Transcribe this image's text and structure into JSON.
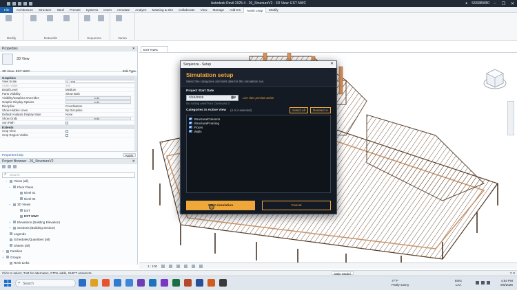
{
  "window": {
    "title": "Autodesk Revit 2025.4 - 26_StructureV2 - 3D View: EST NWC",
    "user": "SSS88W80",
    "min": "–",
    "max": "❐",
    "close": "✕"
  },
  "ribbon_tabs": [
    "File",
    "Architecture",
    "Structure",
    "Steel",
    "Precast",
    "Systems",
    "Insert",
    "Annotate",
    "Analyze",
    "Massing & Site",
    "Collaborate",
    "View",
    "Manage",
    "Add-Ins",
    "Avant Leap",
    "Modify"
  ],
  "active_tab": "Avant Leap",
  "ribbon_groups": [
    {
      "label": "Modify",
      "buttons": [
        "",
        ""
      ]
    },
    {
      "label": "Datacollo",
      "buttons": [
        "",
        "",
        ""
      ]
    },
    {
      "label": "Sequenza",
      "buttons": [
        "",
        "",
        ""
      ]
    },
    {
      "label": "Varian",
      "buttons": [
        "",
        ""
      ]
    }
  ],
  "properties": {
    "header": "Properties",
    "close": "✕",
    "type_name": "3D View",
    "view_selector": "3D View: EST NWC",
    "edit_type": "Edit Type",
    "section_graphics": "Graphics",
    "rows": [
      {
        "k": "View Scale",
        "v": "1 : 100",
        "style": "box"
      },
      {
        "k": "Scale Value",
        "v": "100",
        "style": "dim"
      },
      {
        "k": "Detail Level",
        "v": "Medium",
        "style": ""
      },
      {
        "k": "Parts Visibility",
        "v": "Show Both",
        "style": ""
      },
      {
        "k": "Visibility/Graphics Overrides",
        "v": "Edit...",
        "style": "btn"
      },
      {
        "k": "Graphic Display Options",
        "v": "Edit...",
        "style": "btn"
      },
      {
        "k": "Discipline",
        "v": "Coordination",
        "style": ""
      },
      {
        "k": "Show Hidden Lines",
        "v": "By Discipline",
        "style": ""
      },
      {
        "k": "Default Analysis Display Style",
        "v": "None",
        "style": ""
      },
      {
        "k": "Show Grids",
        "v": "Edit...",
        "style": "btn"
      },
      {
        "k": "Sun Path",
        "v": "",
        "style": "chk"
      }
    ],
    "section_extents": "Extents",
    "rows2": [
      {
        "k": "Crop View",
        "v": "",
        "style": "chk"
      },
      {
        "k": "Crop Region Visible",
        "v": "",
        "style": "chk"
      }
    ],
    "help_link": "Properties help",
    "apply": "Apply"
  },
  "browser": {
    "header": "Project Browser - 26_StructureV2",
    "search_placeholder": "Search",
    "nodes": [
      {
        "text": "Views (all)",
        "indent": 1,
        "toggle": "−",
        "bold": false
      },
      {
        "text": "Floor Plans",
        "indent": 2,
        "toggle": "−",
        "bold": false
      },
      {
        "text": "Nivel 01",
        "indent": 4,
        "toggle": "",
        "bold": false
      },
      {
        "text": "Nivel 04",
        "indent": 4,
        "toggle": "",
        "bold": false
      },
      {
        "text": "3D Views",
        "indent": 2,
        "toggle": "−",
        "bold": false
      },
      {
        "text": "EST",
        "indent": 4,
        "toggle": "",
        "bold": false
      },
      {
        "text": "EST NWC",
        "indent": 4,
        "toggle": "",
        "bold": true
      },
      {
        "text": "Elevations (Building Elevation)",
        "indent": 2,
        "toggle": "+",
        "bold": false
      },
      {
        "text": "Sections (Building Section)",
        "indent": 2,
        "toggle": "+",
        "bold": false
      },
      {
        "text": "Legends",
        "indent": 1,
        "toggle": "",
        "bold": false
      },
      {
        "text": "Schedules/Quantities (all)",
        "indent": 1,
        "toggle": "",
        "bold": false
      },
      {
        "text": "Sheets (all)",
        "indent": 1,
        "toggle": "",
        "bold": false
      },
      {
        "text": "Families",
        "indent": 0,
        "toggle": "+",
        "bold": false
      },
      {
        "text": "Groups",
        "indent": 0,
        "toggle": "+",
        "bold": false
      },
      {
        "text": "Revit Links",
        "indent": 1,
        "toggle": "",
        "bold": false
      }
    ]
  },
  "view_tab": "EST NWC",
  "view_bar": {
    "scale": "1 : 100"
  },
  "status_bar": {
    "hint": "Click to select, TAB for alternates, CTRL adds, SHIFT unselects.",
    "model": "Main Model"
  },
  "dialog": {
    "window_title": "Sequenza - Setup",
    "close": "✕",
    "heading": "Simulation setup",
    "subheading": "Select the categories and start date for this simulation run.",
    "start_date_label": "Project Start Date",
    "start_date_value": "2/24/2026",
    "calendar_icon": "calendar-icon",
    "live_hint": "Live sites preview active",
    "sort_note": "No sorting used from Command 3",
    "categories_label": "Categories in Active View",
    "categories_count": "(4 of 4 selected)",
    "select_all": "Select All",
    "deselect_all": "Deselect A",
    "categories": [
      "StructuralColumns",
      "StructuralFraming",
      "Floors",
      "Walls"
    ],
    "start_button": "Start simulation",
    "cancel_button": "Cancel"
  },
  "taskbar": {
    "search_placeholder": "Search",
    "apps": [
      "#2b6cc4",
      "#e0a020",
      "#e8542c",
      "#2e7bcf",
      "#3f86d9",
      "#6b3fb4",
      "#1e73be",
      "#7a38c2",
      "#1d6f42",
      "#b7472a",
      "#2a4f9a",
      "#d25b1f",
      "#3a3a3a"
    ],
    "weather_temp": "77°F",
    "weather_desc": "Partly sunny",
    "lang": "ENG",
    "region": "LAA",
    "time": "4:54 PM",
    "date": "5/5/2026"
  },
  "colors": {
    "accent": "#f0a73a",
    "dialog_bg": "#141a23",
    "checkbox": "#3b7ed6",
    "ribbon_file": "#1d5fa8"
  }
}
